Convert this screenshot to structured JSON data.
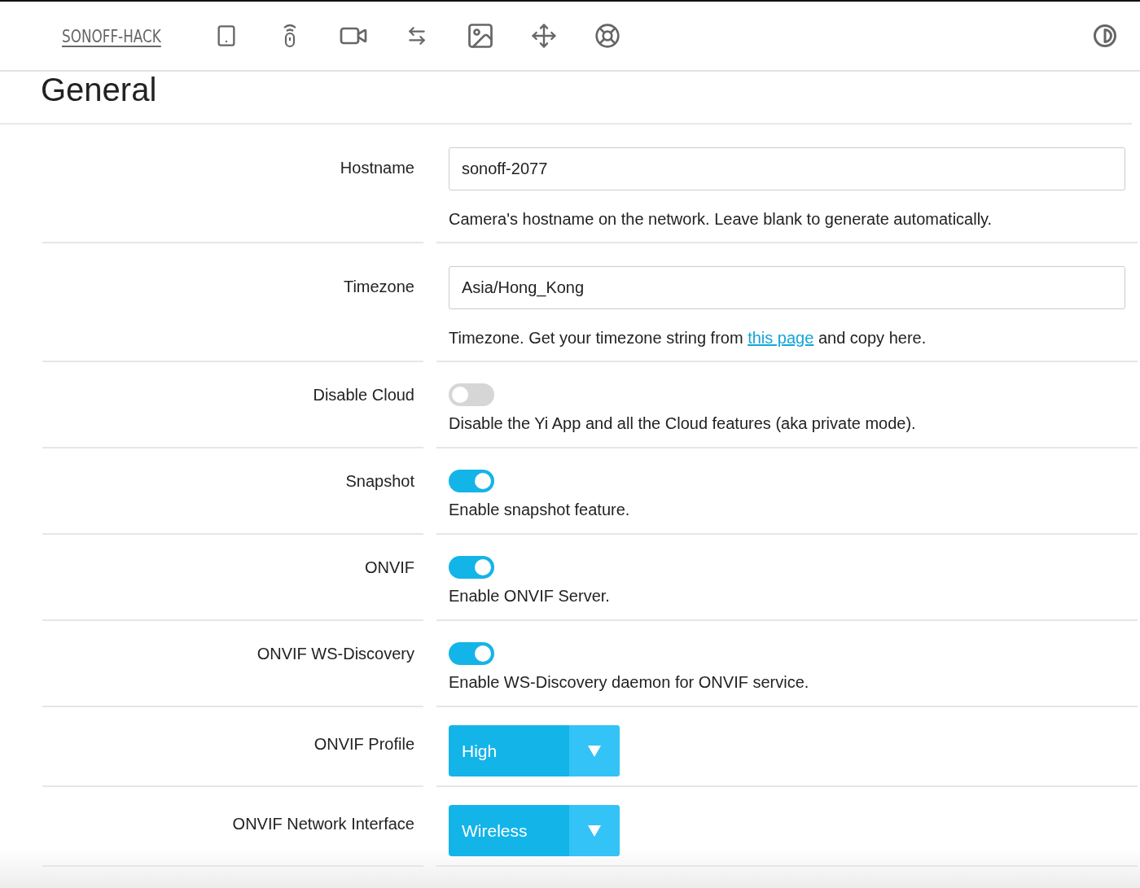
{
  "nav": {
    "brand": "SONOFF-HACK"
  },
  "page": {
    "title": "General"
  },
  "rows": [
    {
      "kind": "text",
      "label": "Hostname",
      "value": "sonoff-2077",
      "help": [
        {
          "kind": "text",
          "text": "Camera's hostname on the network. Leave blank to generate automatically."
        }
      ]
    },
    {
      "kind": "text",
      "label": "Timezone",
      "value": "Asia/Hong_Kong",
      "help": [
        {
          "kind": "text",
          "text": "Timezone. Get your timezone string from "
        },
        {
          "kind": "link",
          "text": "this page"
        },
        {
          "kind": "text",
          "text": " and copy here."
        }
      ]
    },
    {
      "kind": "toggle",
      "label": "Disable Cloud",
      "on": false,
      "help": [
        {
          "kind": "text",
          "text": "Disable the Yi App and all the Cloud features (aka private mode)."
        }
      ]
    },
    {
      "kind": "toggle",
      "label": "Snapshot",
      "on": true,
      "help": [
        {
          "kind": "text",
          "text": "Enable snapshot feature."
        }
      ]
    },
    {
      "kind": "toggle",
      "label": "ONVIF",
      "on": true,
      "help": [
        {
          "kind": "text",
          "text": "Enable ONVIF Server."
        }
      ]
    },
    {
      "kind": "toggle",
      "label": "ONVIF WS-Discovery",
      "on": true,
      "help": [
        {
          "kind": "text",
          "text": "Enable WS-Discovery daemon for ONVIF service."
        }
      ]
    },
    {
      "kind": "select",
      "label": "ONVIF Profile",
      "value": "High"
    },
    {
      "kind": "select",
      "label": "ONVIF Network Interface",
      "value": "Wireless"
    }
  ]
}
